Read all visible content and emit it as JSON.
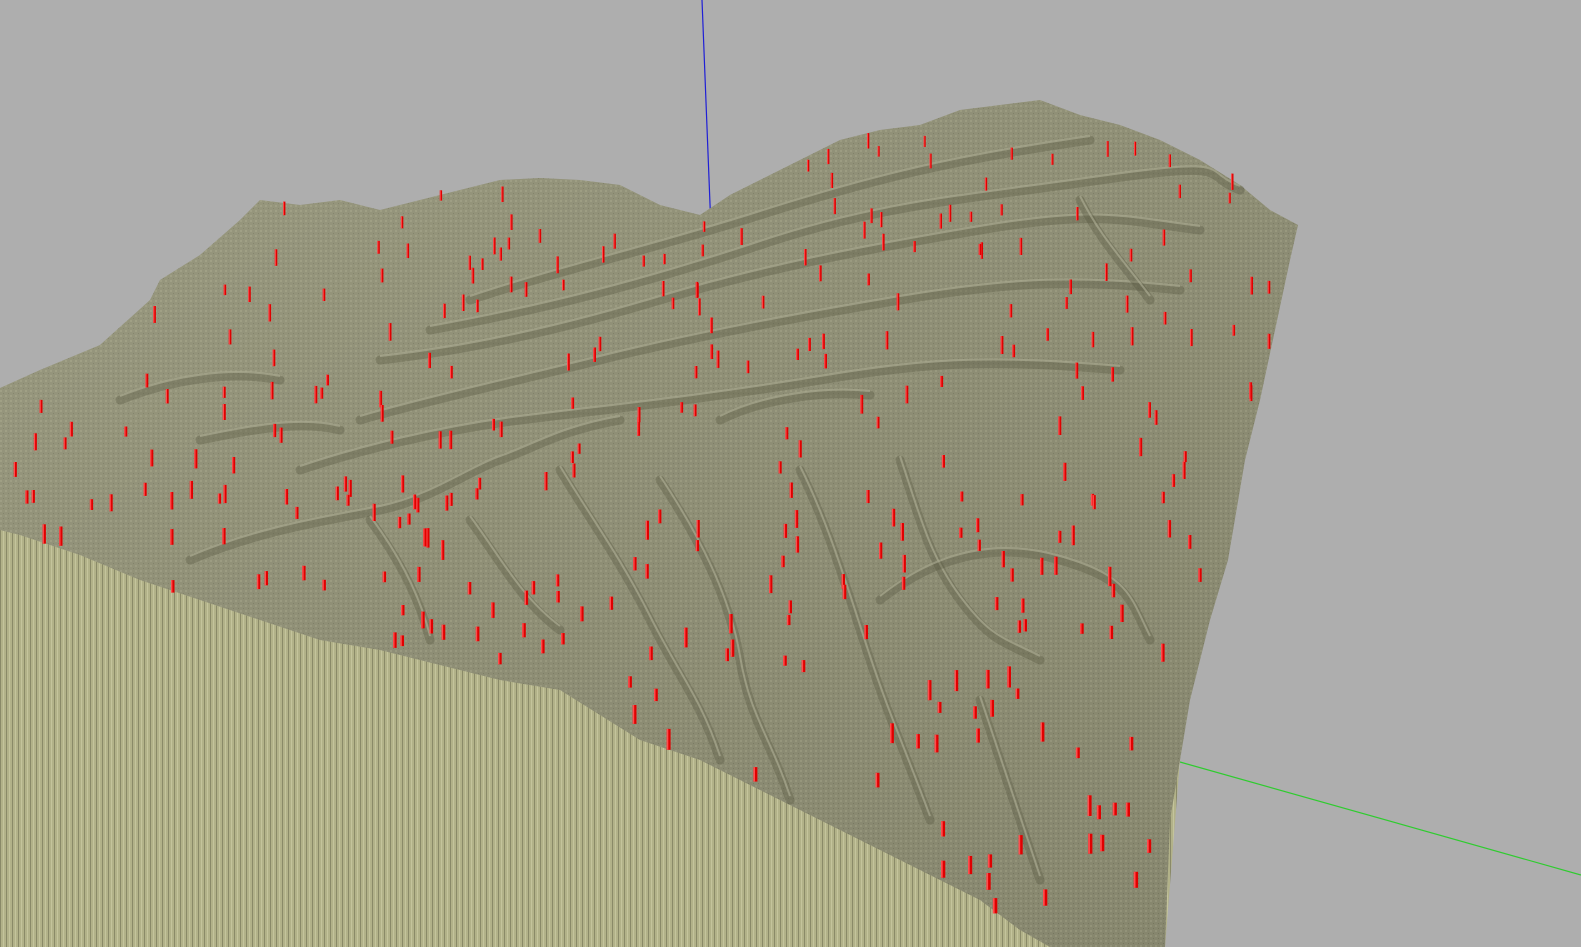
{
  "viewer": {
    "background_color": "#aeaeae",
    "terrain_top_color": "#8f8f74",
    "terrain_side_color": "#b4b48c",
    "marker_color": "#e00000",
    "axes": {
      "x_color": "#ff2a2a",
      "y_color": "#2ecc2e",
      "z_color": "#1f1fd6"
    },
    "marker_count": 320
  }
}
